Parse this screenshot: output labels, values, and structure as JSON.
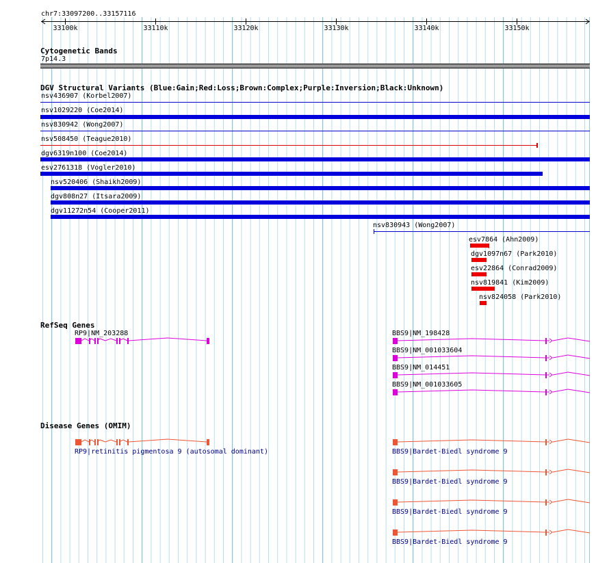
{
  "region": "chr7:33097200..33157116",
  "ruler": {
    "ticks": [
      "33100k",
      "33110k",
      "33120k",
      "33130k",
      "33140k",
      "33150k"
    ]
  },
  "cyto": {
    "title": "Cytogenetic Bands",
    "band": "7p14.3",
    "band_color": "#999999"
  },
  "dgv": {
    "title": "DGV Structural Variants (Blue:Gain;Red:Loss;Brown:Complex;Purple:Inversion;Black:Unknown)",
    "items": [
      {
        "label": "nsv436907 (Korbel2007)",
        "kind": "thin",
        "color": "#0000cc"
      },
      {
        "label": "nsv1029220 (Coe2014)",
        "kind": "thick",
        "color": "#0000dd"
      },
      {
        "label": "nsv830942 (Wong2007)",
        "kind": "thin",
        "color": "#0000cc"
      },
      {
        "label": "nsv508450 (Teague2010)",
        "kind": "thin",
        "color": "#dd0000"
      },
      {
        "label": "dgv6319n100 (Coe2014)",
        "kind": "thick",
        "color": "#0000dd"
      },
      {
        "label": "esv2761318 (Vogler2010)",
        "kind": "thick",
        "color": "#0000dd"
      },
      {
        "label": "nsv520406 (Shaikh2009)",
        "kind": "thick",
        "color": "#0000dd"
      },
      {
        "label": "dgv808n27 (Itsara2009)",
        "kind": "thick",
        "color": "#0000dd"
      },
      {
        "label": "dgv11272n54 (Cooper2011)",
        "kind": "thick",
        "color": "#0000dd"
      },
      {
        "label": "nsv830943 (Wong2007)",
        "kind": "thin",
        "color": "#0000cc"
      },
      {
        "label": "esv7864 (Ahn2009)",
        "kind": "thick",
        "color": "#ee0000"
      },
      {
        "label": "dgv1097n67 (Park2010)",
        "kind": "thick",
        "color": "#ee0000"
      },
      {
        "label": "esv22864 (Conrad2009)",
        "kind": "thick",
        "color": "#ee0000"
      },
      {
        "label": "nsv819841 (Kim2009)",
        "kind": "thick",
        "color": "#ee0000"
      },
      {
        "label": "nsv824058 (Park2010)",
        "kind": "thick",
        "color": "#ee0000"
      }
    ]
  },
  "refseq": {
    "title": "RefSeq Genes",
    "color": "#dd00dd",
    "genes": [
      {
        "label": "RP9|NM_203288"
      },
      {
        "label": "BBS9|NM_198428"
      },
      {
        "label": "BBS9|NM_001033604"
      },
      {
        "label": "BBS9|NM_014451"
      },
      {
        "label": "BBS9|NM_001033605"
      }
    ]
  },
  "omim": {
    "title": "Disease Genes (OMIM)",
    "color": "#ee5533",
    "label_color": "#000088",
    "genes": [
      {
        "label": "RP9|retinitis pigmentosa 9 (autosomal dominant)"
      },
      {
        "label": "BBS9|Bardet-Biedl syndrome 9"
      },
      {
        "label": "BBS9|Bardet-Biedl syndrome 9"
      },
      {
        "label": "BBS9|Bardet-Biedl syndrome 9"
      },
      {
        "label": "BBS9|Bardet-Biedl syndrome 9"
      }
    ]
  }
}
